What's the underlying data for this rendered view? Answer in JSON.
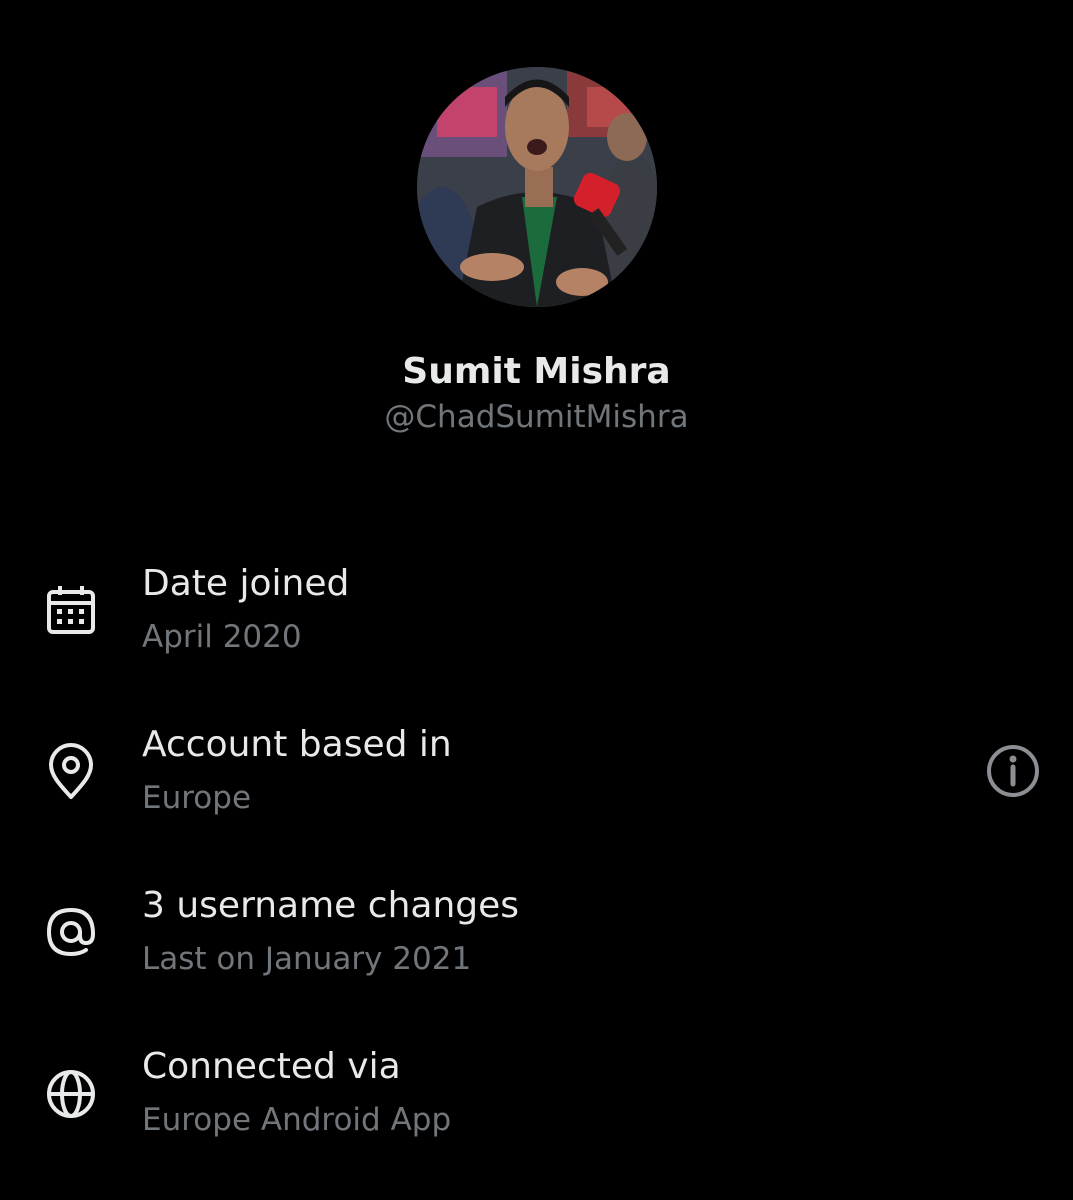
{
  "profile": {
    "display_name": "Sumit Mishra",
    "handle": "@ChadSumitMishra"
  },
  "about": {
    "items": [
      {
        "icon": "calendar-icon",
        "title": "Date joined",
        "subtitle": "April 2020"
      },
      {
        "icon": "location-pin-icon",
        "title": "Account based in",
        "subtitle": "Europe"
      },
      {
        "icon": "at-sign-icon",
        "title": "3 username changes",
        "subtitle": "Last on January 2021"
      },
      {
        "icon": "globe-icon",
        "title": "Connected via",
        "subtitle": "Europe Android App"
      }
    ],
    "info_icon": "info-icon"
  },
  "colors": {
    "background": "#000000",
    "primary_text": "#e7e9ea",
    "secondary_text": "#71767b"
  }
}
